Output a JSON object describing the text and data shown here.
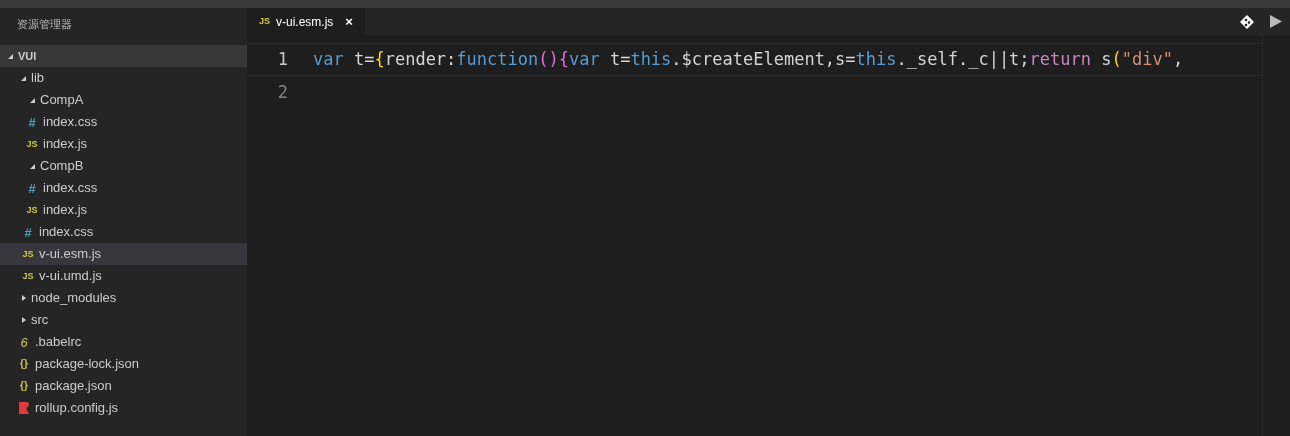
{
  "sidebar": {
    "title": "资源管理器",
    "tree": [
      {
        "label": "VUI",
        "kind": "folder",
        "expanded": true,
        "selected": false,
        "children": [
          {
            "label": "lib",
            "kind": "folder",
            "expanded": true,
            "selected": false,
            "children": [
              {
                "label": "CompA",
                "kind": "folder",
                "expanded": true,
                "selected": false,
                "children": [
                  {
                    "label": "index.css",
                    "kind": "css",
                    "icon": "#",
                    "selected": false
                  },
                  {
                    "label": "index.js",
                    "kind": "js",
                    "icon": "JS",
                    "selected": false
                  }
                ]
              },
              {
                "label": "CompB",
                "kind": "folder",
                "expanded": true,
                "selected": false,
                "children": [
                  {
                    "label": "index.css",
                    "kind": "css",
                    "icon": "#",
                    "selected": false
                  },
                  {
                    "label": "index.js",
                    "kind": "js",
                    "icon": "JS",
                    "selected": false
                  }
                ]
              },
              {
                "label": "index.css",
                "kind": "css",
                "icon": "#",
                "selected": false
              },
              {
                "label": "v-ui.esm.js",
                "kind": "js",
                "icon": "JS",
                "selected": true
              },
              {
                "label": "v-ui.umd.js",
                "kind": "js",
                "icon": "JS",
                "selected": false
              }
            ]
          },
          {
            "label": "node_modules",
            "kind": "folder",
            "expanded": false,
            "selected": false
          },
          {
            "label": "src",
            "kind": "folder",
            "expanded": false,
            "selected": false
          },
          {
            "label": ".babelrc",
            "kind": "babel",
            "icon": "6",
            "selected": false
          },
          {
            "label": "package-lock.json",
            "kind": "json",
            "icon": "{}",
            "selected": false
          },
          {
            "label": "package.json",
            "kind": "json",
            "icon": "{}",
            "selected": false
          },
          {
            "label": "rollup.config.js",
            "kind": "rollup",
            "selected": false
          }
        ]
      }
    ]
  },
  "tabs": [
    {
      "label": "v-ui.esm.js",
      "icon": "JS",
      "close": "×",
      "selected": true
    }
  ],
  "editor": {
    "lines": [
      {
        "number": "1",
        "current": true,
        "tokens": [
          {
            "text": "var",
            "kind": "keyword"
          },
          {
            "text": " t=",
            "kind": "plain"
          },
          {
            "text": "{",
            "kind": "brace"
          },
          {
            "text": "render:",
            "kind": "plain"
          },
          {
            "text": "function",
            "kind": "keyword"
          },
          {
            "text": "(){",
            "kind": "paren"
          },
          {
            "text": "var",
            "kind": "keyword"
          },
          {
            "text": " t=",
            "kind": "plain"
          },
          {
            "text": "this",
            "kind": "keyword"
          },
          {
            "text": ".$createElement,s=",
            "kind": "plain"
          },
          {
            "text": "this",
            "kind": "keyword"
          },
          {
            "text": "._self._c||t;",
            "kind": "plain"
          },
          {
            "text": "return",
            "kind": "control"
          },
          {
            "text": " s",
            "kind": "plain"
          },
          {
            "text": "(",
            "kind": "brace"
          },
          {
            "text": "\"div\"",
            "kind": "string"
          },
          {
            "text": ",",
            "kind": "plain"
          }
        ]
      },
      {
        "number": "2",
        "current": false
      }
    ]
  }
}
